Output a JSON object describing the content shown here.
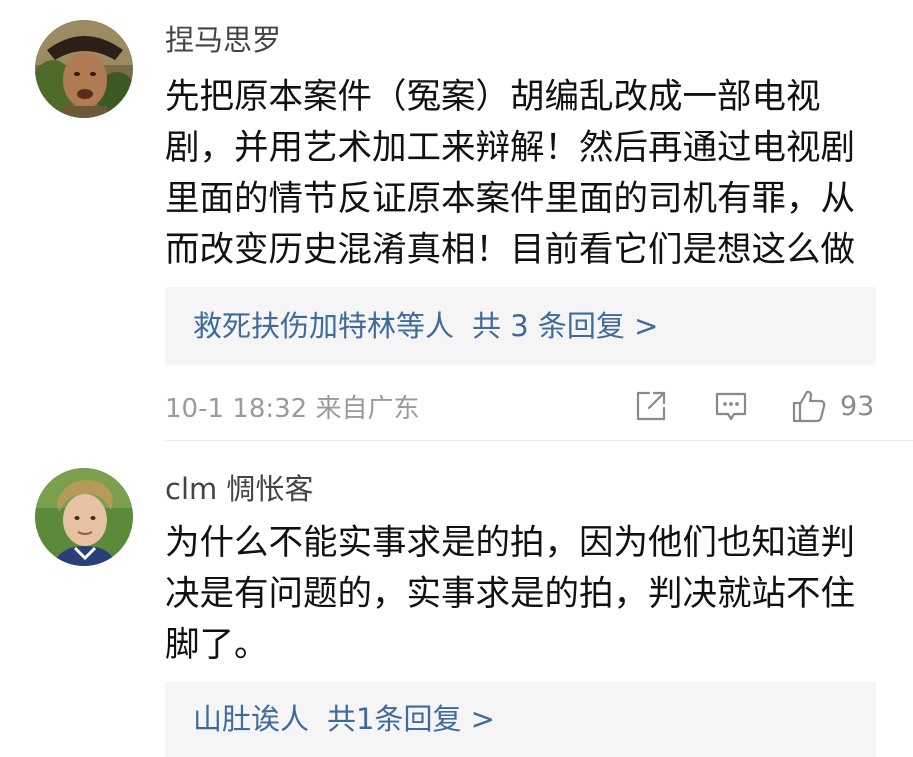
{
  "comments": [
    {
      "username": "捏马思罗",
      "text_lines": [
        "先把原本案件（冤案）胡编乱改成一部电视",
        "剧，并用艺术加工来辩解！然后再通过电视剧",
        "里面的情节反证原本案件里面的司机有罪，从",
        "而改变历史混淆真相！目前看它们是想这么做"
      ],
      "reply_names": "救死扶伤加特林",
      "reply_suffix": "等人",
      "reply_count": "共 3 条回复 >",
      "timestamp": "10-1 18:32 来自广东",
      "likes": "93",
      "icons": [
        "avatar",
        "share-icon",
        "reply-icon",
        "like-icon"
      ]
    },
    {
      "username": "clm 惆怅客",
      "text_lines": [
        "为什么不能实事求是的拍，因为他们也知道判",
        "决是有问题的，实事求是的拍，判决就站不住",
        "脚了。"
      ],
      "reply_names": "山肚诶人",
      "reply_count": "共1条回复 >"
    }
  ],
  "colors": {
    "link": "#3f6a9b",
    "meta": "#9a9a9a",
    "reply_bg": "#f5f5f5"
  }
}
